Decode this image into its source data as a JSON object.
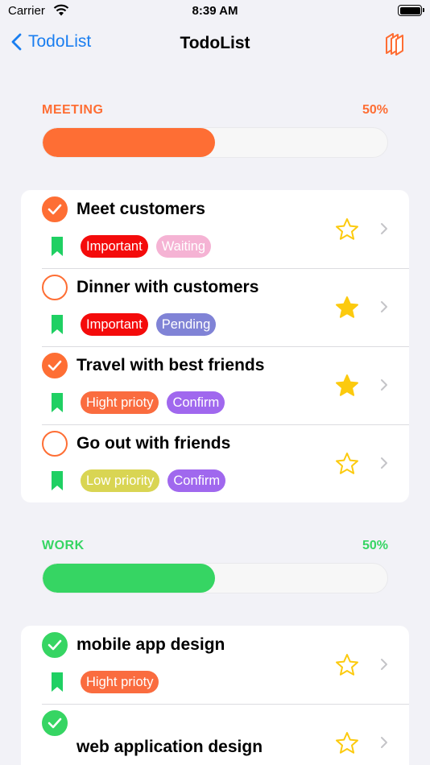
{
  "status_bar": {
    "carrier": "Carrier",
    "time": "8:39 AM"
  },
  "nav": {
    "back_label": "TodoList",
    "title": "TodoList"
  },
  "colors": {
    "accent_orange": "#fe6e34",
    "green": "#36d563",
    "blue": "#1a7ef0",
    "star": "#fcca0e",
    "bookmark": "#1fd063"
  },
  "sections": [
    {
      "name": "MEETING",
      "percent_label": "50%",
      "progress": 0.5,
      "color": "#fe6e34",
      "items": [
        {
          "title": "Meet customers",
          "done": true,
          "starred": false,
          "tags": [
            {
              "label": "Important",
              "color": "#f40b0b"
            },
            {
              "label": "Waiting",
              "color": "#f5b3d4"
            }
          ]
        },
        {
          "title": "Dinner with customers",
          "done": false,
          "starred": true,
          "tags": [
            {
              "label": "Important",
              "color": "#f40b0b"
            },
            {
              "label": "Pending",
              "color": "#8083d6"
            }
          ]
        },
        {
          "title": "Travel with best friends",
          "done": true,
          "starred": true,
          "tags": [
            {
              "label": "Hight prioty",
              "color": "#fa6c3f"
            },
            {
              "label": "Confirm",
              "color": "#a068ee"
            }
          ]
        },
        {
          "title": "Go out with friends",
          "done": false,
          "starred": false,
          "tags": [
            {
              "label": "Low priority",
              "color": "#d9d553"
            },
            {
              "label": "Confirm",
              "color": "#a068ee"
            }
          ]
        }
      ]
    },
    {
      "name": "WORK",
      "percent_label": "50%",
      "progress": 0.5,
      "color": "#36d563",
      "items": [
        {
          "title": "mobile app design",
          "done": true,
          "starred": false,
          "tags": [
            {
              "label": "Hight prioty",
              "color": "#fa6c3f"
            }
          ]
        },
        {
          "title": "web application design",
          "done": true,
          "starred": false,
          "tags": []
        }
      ]
    }
  ]
}
